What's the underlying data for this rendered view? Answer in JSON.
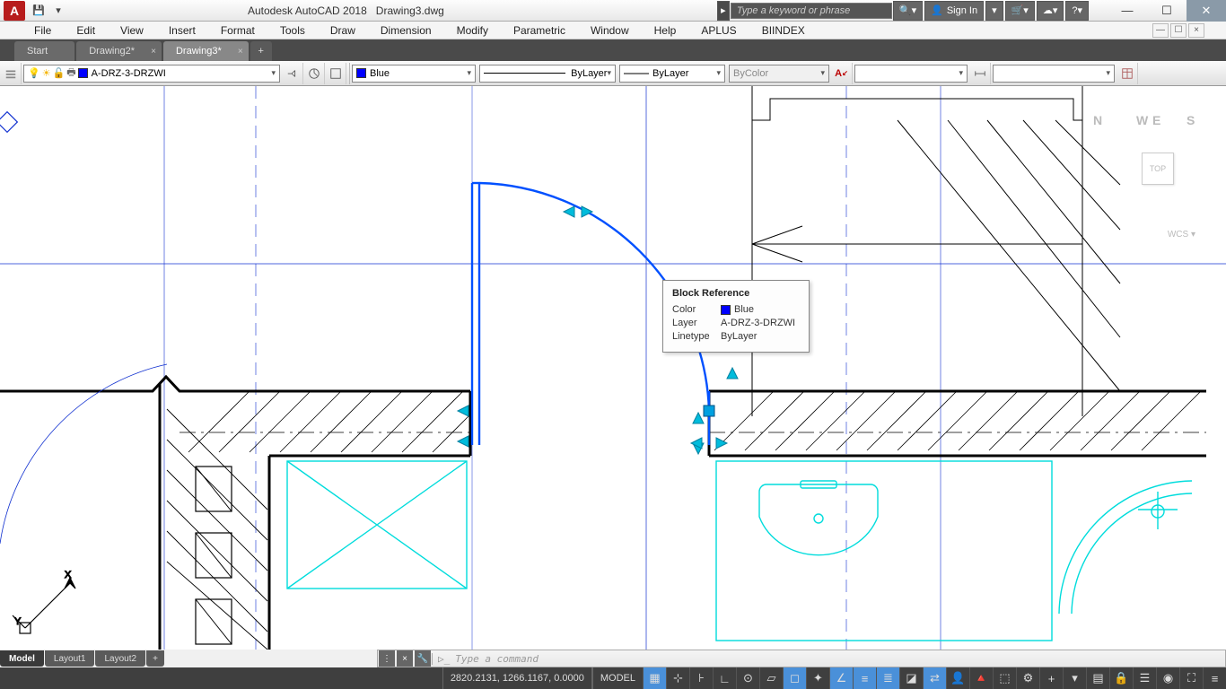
{
  "title": {
    "app": "Autodesk AutoCAD 2018",
    "file": "Drawing3.dwg"
  },
  "search": {
    "placeholder": "Type a keyword or phrase"
  },
  "signin": "Sign In",
  "menus": [
    "File",
    "Edit",
    "View",
    "Insert",
    "Format",
    "Tools",
    "Draw",
    "Dimension",
    "Modify",
    "Parametric",
    "Window",
    "Help",
    "APLUS",
    "BIINDEX"
  ],
  "doctabs": [
    {
      "label": "Start",
      "closable": false
    },
    {
      "label": "Drawing2*",
      "closable": true
    },
    {
      "label": "Drawing3*",
      "closable": true,
      "active": true
    }
  ],
  "toolbar": {
    "layer": {
      "name": "A-DRZ-3-DRZWI",
      "swatch": "#0000ff"
    },
    "color": {
      "label": "Blue",
      "swatch": "#0000ff"
    },
    "linetype": {
      "label": "ByLayer"
    },
    "lineweight": {
      "label": "ByLayer"
    },
    "plotstyle": {
      "label": "ByColor"
    },
    "textstyle": {
      "label": ""
    },
    "dimstyle": {
      "label": ""
    }
  },
  "tooltip": {
    "title": "Block Reference",
    "rows": [
      {
        "k": "Color",
        "v": "Blue",
        "swatch": "#0000ff"
      },
      {
        "k": "Layer",
        "v": "A-DRZ-3-DRZWI"
      },
      {
        "k": "Linetype",
        "v": "ByLayer"
      }
    ]
  },
  "viewcube": {
    "face": "TOP",
    "dirs": {
      "n": "N",
      "e": "E",
      "s": "S",
      "w": "W"
    },
    "wcs": "WCS ▾"
  },
  "cmdline": {
    "placeholder": "Type a command"
  },
  "bottomtabs": [
    {
      "label": "Model",
      "active": true
    },
    {
      "label": "Layout1"
    },
    {
      "label": "Layout2"
    }
  ],
  "statusbar": {
    "coords": "2820.2131, 1266.1167, 0.0000",
    "space": "MODEL"
  }
}
